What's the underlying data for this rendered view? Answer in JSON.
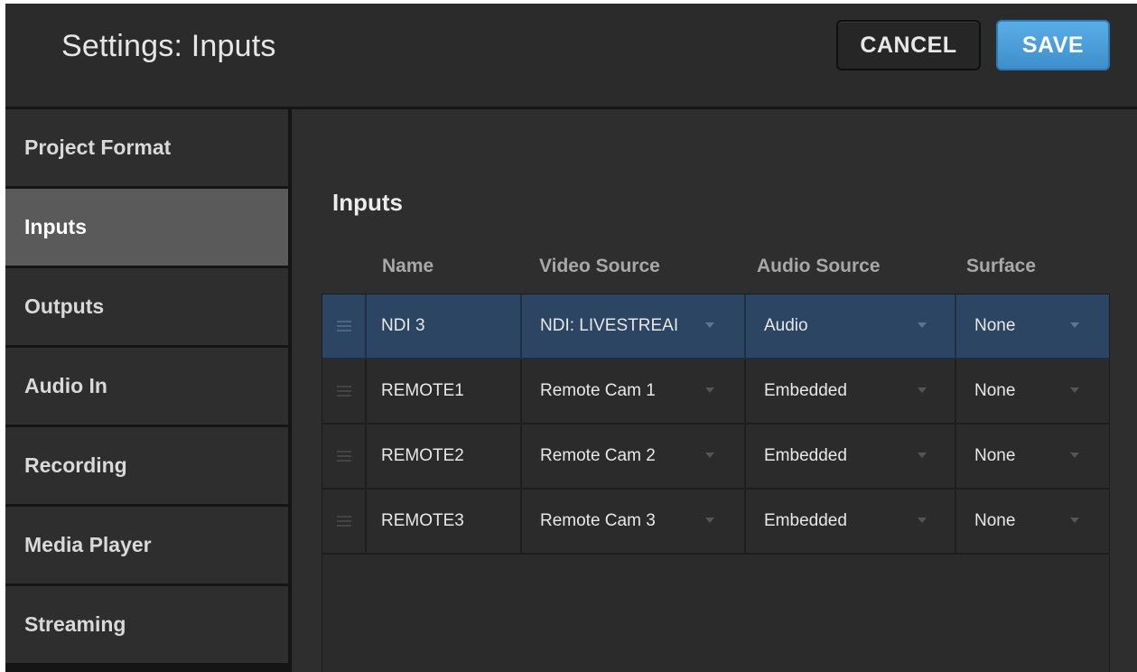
{
  "header": {
    "title": "Settings: Inputs",
    "cancel_label": "CANCEL",
    "save_label": "SAVE"
  },
  "sidebar": {
    "items": [
      {
        "label": "Project Format",
        "active": false
      },
      {
        "label": "Inputs",
        "active": true
      },
      {
        "label": "Outputs",
        "active": false
      },
      {
        "label": "Audio In",
        "active": false
      },
      {
        "label": "Recording",
        "active": false
      },
      {
        "label": "Media Player",
        "active": false
      },
      {
        "label": "Streaming",
        "active": false
      }
    ]
  },
  "main": {
    "section_title": "Inputs",
    "columns": [
      "Name",
      "Video Source",
      "Audio Source",
      "Surface"
    ],
    "rows": [
      {
        "name": "NDI 3",
        "video": "NDI: LIVESTREAI",
        "audio": "Audio",
        "surface": "None",
        "selected": true
      },
      {
        "name": "REMOTE1",
        "video": "Remote Cam 1",
        "audio": "Embedded",
        "surface": "None",
        "selected": false
      },
      {
        "name": "REMOTE2",
        "video": "Remote Cam 2",
        "audio": "Embedded",
        "surface": "None",
        "selected": false
      },
      {
        "name": "REMOTE3",
        "video": "Remote Cam 3",
        "audio": "Embedded",
        "surface": "None",
        "selected": false
      }
    ]
  },
  "colors": {
    "accent": "#4a9fdc",
    "selected_row": "#2b4563",
    "active_sidebar": "#5a5a5a"
  },
  "icons": {
    "row_handle": "drag-handle-icon",
    "dropdown": "chevron-down-icon"
  }
}
